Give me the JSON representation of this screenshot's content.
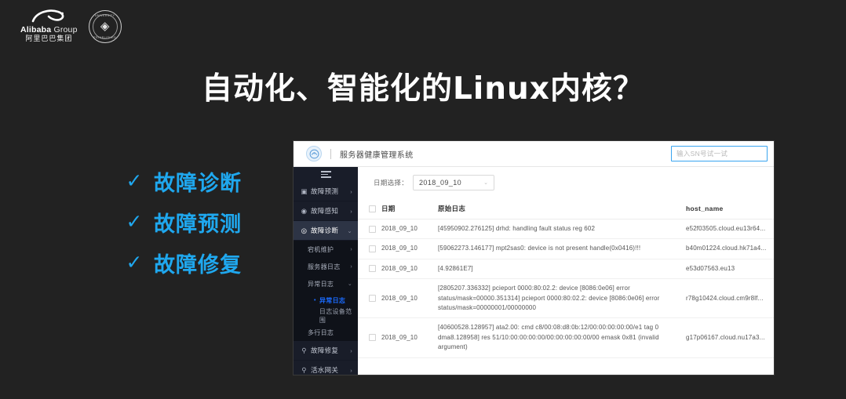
{
  "slide": {
    "background_color": "#222222",
    "title": "自动化、智能化的Linux内核？",
    "accent_color": "#1fa8ef"
  },
  "logos": {
    "alibaba_name_en": "Alibaba",
    "alibaba_name_group": " Group",
    "alibaba_name_cn": "阿里巴巴集团",
    "university_arc_top": "UNIVERSITY",
    "university_arc_bottom": "ESTABLISHED",
    "university_crest": "◈"
  },
  "bullets": [
    {
      "tick": "✓",
      "label": "故障诊断"
    },
    {
      "tick": "✓",
      "label": "故障预测"
    },
    {
      "tick": "✓",
      "label": "故障修复"
    }
  ],
  "app": {
    "header": {
      "title": "服务器健康管理系统",
      "search_placeholder": "输入SN号试一试"
    },
    "sidebar": {
      "items": [
        {
          "icon": "chart-icon",
          "glyph": "▣",
          "label": "故障预测",
          "arrow": "›",
          "active": false
        },
        {
          "icon": "eye-icon",
          "glyph": "◉",
          "label": "故障感知",
          "arrow": "›",
          "active": false
        },
        {
          "icon": "stethoscope-icon",
          "glyph": "◎",
          "label": "故障诊断",
          "arrow": "⌄",
          "active": true
        }
      ],
      "sub_items": [
        {
          "label": "宕机维护",
          "arrow": "›"
        },
        {
          "label": "服务器日志",
          "arrow": "›"
        },
        {
          "label": "异常日志",
          "arrow": "⌄"
        }
      ],
      "sub2_items": [
        {
          "label": "异常日志",
          "selected": true
        },
        {
          "label": "日志设备范围",
          "selected": false
        }
      ],
      "sub_items_tail": [
        {
          "label": "多行日志",
          "arrow": ""
        }
      ],
      "bottom_items": [
        {
          "icon": "wrench-icon",
          "glyph": "⚲",
          "label": "故障修复",
          "arrow": "›"
        },
        {
          "icon": "gateway-icon",
          "glyph": "⚲",
          "label": "活水网关",
          "arrow": "›"
        }
      ]
    },
    "filter": {
      "label": "日期选择：",
      "selected_date": "2018_09_10",
      "caret": "⌄"
    },
    "table": {
      "columns": [
        "",
        "日期",
        "原始日志",
        "host_name"
      ],
      "rows": [
        {
          "date": "2018_09_10",
          "log": "[45950902.276125] drhd: handling fault status reg 602",
          "host": "e52f03505.cloud.eu13r64..."
        },
        {
          "date": "2018_09_10",
          "log": "[59062273.146177] mpt2sas0: device is not present handle(0x0416)!!!",
          "host": "b40m01224.cloud.hk71a4..."
        },
        {
          "date": "2018_09_10",
          "log": "[4.92861E7]",
          "host": "e53d07563.eu13"
        },
        {
          "date": "2018_09_10",
          "log": "[2805207.336332] pcieport 0000:80:02.2: device [8086:0e06] error status/mask=00000.351314] pcieport 0000:80:02.2: device [8086:0e06] error status/mask=00000001/00000000",
          "host": "r78g10424.cloud.cm9r8lf..."
        },
        {
          "date": "2018_09_10",
          "log": "[40600528.128957] ata2.00: cmd c8/00:08:d8:0b:12/00:00:00:00:00/e1 tag 0 dma8.128958] res 51/10:00:00:00:00/00:00:00:00:00/00 emask 0x81 (invalid argument)",
          "host": "g17p06167.cloud.nu17a3..."
        }
      ]
    }
  }
}
